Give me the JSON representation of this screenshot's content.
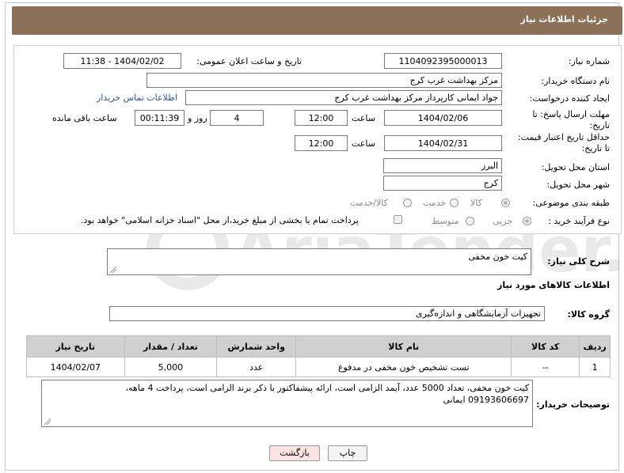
{
  "header": {
    "title": "جزئیات اطلاعات نیاز"
  },
  "form": {
    "need_number_label": "شماره نیاز:",
    "need_number": "1104092395000013",
    "announce_label": "تاریخ و ساعت اعلان عمومی:",
    "announce_value": "1404/02/02 - 11:38",
    "buyer_org_label": "نام دستگاه خریدار:",
    "buyer_org": "مرکز بهداشت غرب کرج",
    "creator_label": "ایجاد کننده درخواست:",
    "creator": "جواد ایمانی کارپرداز مرکز بهداشت غرب کرج",
    "contact_link": "اطلاعات تماس خریدار",
    "deadline_label_1": "مهلت ارسال پاسخ: تا",
    "deadline_label_2": "تاریخ:",
    "deadline_date": "1404/02/06",
    "time_label": "ساعت",
    "deadline_time": "12:00",
    "days_value": "4",
    "days_label": "روز و",
    "remaining_time": "00:11:39",
    "remaining_label": "ساعت باقی مانده",
    "price_validity_label_1": "حداقل تاریخ اعتبار قیمت:",
    "price_validity_label_2": "تا تاریخ:",
    "price_validity_date": "1404/02/31",
    "price_validity_time": "12:00",
    "province_label": "استان محل تحویل:",
    "province": "البرز",
    "city_label": "شهر محل تحویل:",
    "city": "کرج",
    "category_label": "طبقه بندی موضوعی:",
    "category_options": [
      "کالا",
      "خدمت",
      "کالا/خدمت"
    ],
    "process_label": "نوع فرآیند خرید :",
    "process_options": [
      "جزیی",
      "متوسط"
    ],
    "payment_note": "پرداخت تمام یا بخشی از مبلغ خرید،از محل \"اسناد خزانه اسلامی\" خواهد بود."
  },
  "summary": {
    "label": "شرح کلی نیاز:",
    "value": "کیت خون مخفی"
  },
  "goods_section": {
    "title": "اطلاعات کالاهای مورد نیاز",
    "group_label": "گروه کالا:",
    "group_value": "تجهیزات آزمایشگاهی و اندازه‌گیری"
  },
  "table": {
    "headers": [
      "ردیف",
      "کد کالا",
      "نام کالا",
      "واحد شمارش",
      "تعداد / مقدار",
      "تاریخ نیاز"
    ],
    "rows": [
      {
        "row": "1",
        "code": "--",
        "name": "تست تشخیص خون مخفی در مدفوع",
        "unit": "عدد",
        "qty": "5,000",
        "date": "1404/02/07"
      }
    ]
  },
  "buyer_notes": {
    "label": "توضیحات خریدار:",
    "line1": "کیت خون مخفی، تعداد 5000 عدد، آیمد الزامی است، ارائه پیشفاکتور با ذکر برند الزامی است، پرداخت 4 ماهه،",
    "line2": "09193606697 ایمانی"
  },
  "buttons": {
    "print": "چاپ",
    "back": "بازگشت"
  },
  "watermark": "AriaTender.neT",
  "colors": {
    "titlebar": "#8a7158",
    "link": "#2a56b8",
    "back_button": "#fbe3e3"
  }
}
